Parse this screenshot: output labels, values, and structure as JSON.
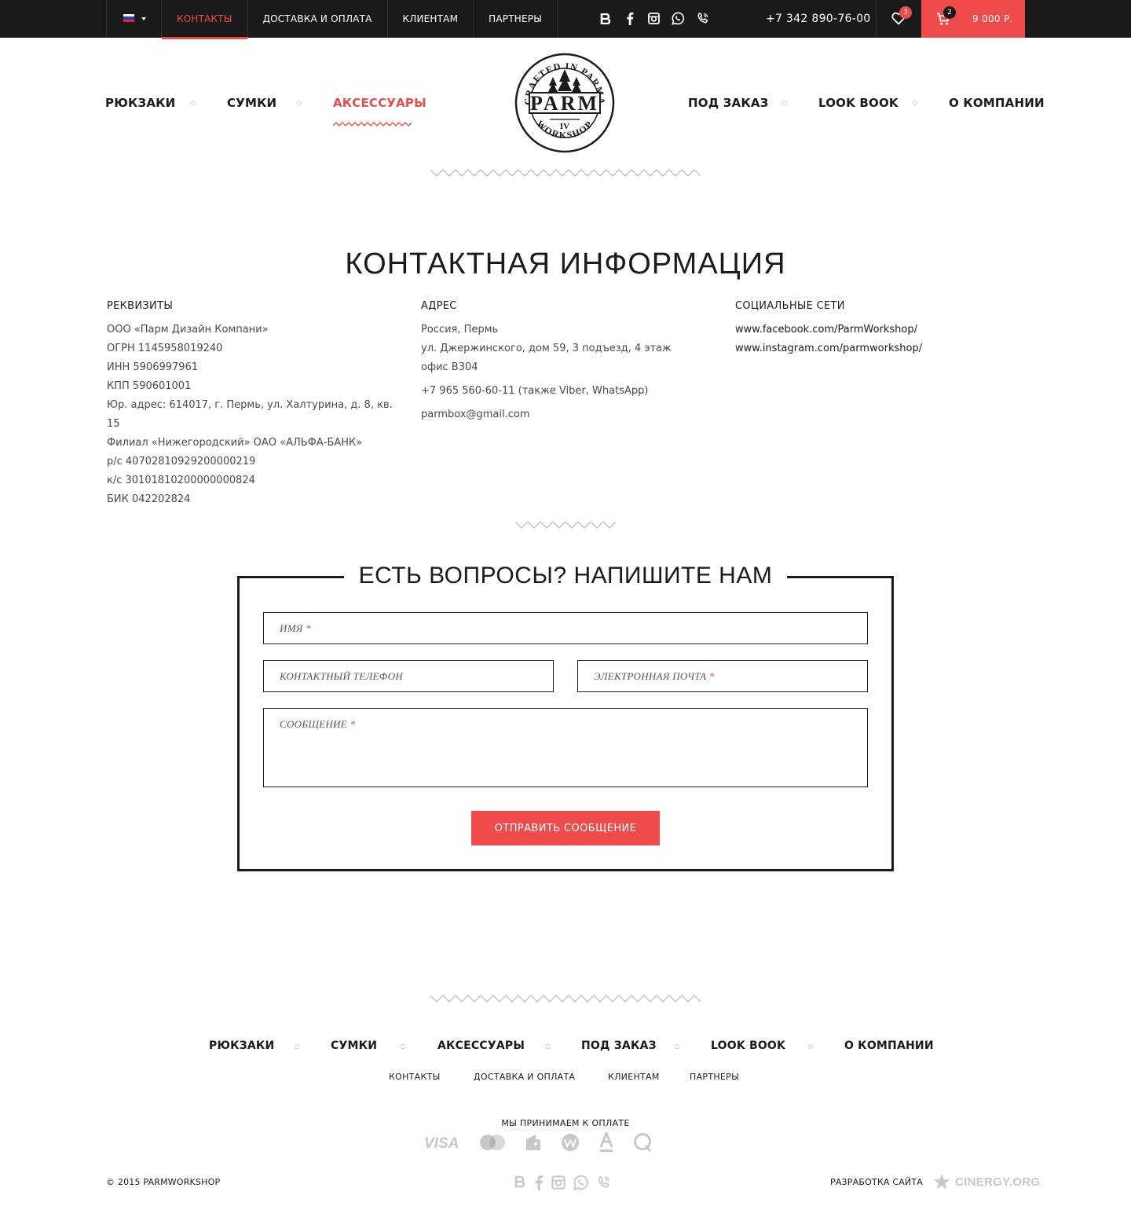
{
  "topbar": {
    "lang_flag": "ru-flag-icon",
    "links": [
      {
        "label": "КОНТАКТЫ",
        "active": true
      },
      {
        "label": "ДОСТАВКА И ОПЛАТА"
      },
      {
        "label": "КЛИЕНТАМ"
      },
      {
        "label": "ПАРТНЕРЫ"
      }
    ],
    "social_icons": [
      "vk-icon",
      "facebook-icon",
      "instagram-icon",
      "whatsapp-icon",
      "viber-icon"
    ],
    "phone": "+7 342 890-76-00",
    "favorites_count": "3",
    "cart_count": "2",
    "cart_total": "9 000 Р."
  },
  "main_nav": {
    "left": [
      "РЮКЗАКИ",
      "СУМКИ",
      "АКСЕССУАРЫ"
    ],
    "right": [
      "ПОД ЗАКАЗ",
      "LOOK BOOK",
      "О КОМПАНИИ"
    ],
    "active": "АКСЕССУАРЫ"
  },
  "logo": {
    "top_text": "CRAFTED IN PARMA",
    "main_text": "PARM",
    "numeral": "IV",
    "bottom_text": "WORKSHOP"
  },
  "page_title": "КОНТАКТНАЯ ИНФОРМАЦИЯ",
  "requisites": {
    "heading": "РЕКВИЗИТЫ",
    "lines": [
      "ООО «Парм Дизайн Компани»",
      "ОГРН 1145958019240",
      "ИНН 5906997961",
      "КПП 590601001",
      "Юр. адрес: 614017, г. Пермь, ул. Халтурина, д. 8, кв. 15",
      "Филиал «Нижегородский» ОАО «АЛЬФА-БАНК»",
      "р/с 40702810929200000219",
      "к/с 30101810200000000824",
      "БИК 042202824"
    ]
  },
  "address": {
    "heading": "АДРЕС",
    "lines": [
      "Россия, Пермь",
      "ул. Джержинского, дом 59, 3 подъезд, 4 этаж",
      "офис В304"
    ],
    "phone": "+7 965 560-60-11 (также Viber, WhatsApp)",
    "email": "parmbox@gmail.com"
  },
  "social": {
    "heading": "СОЦИАЛЬНЫЕ СЕТИ",
    "links": [
      "www.facebook.com/ParmWorkshop/",
      "www.instagram.com/parmworkshop/"
    ]
  },
  "form": {
    "title": "ЕСТЬ ВОПРОСЫ? НАПИШИТЕ НАМ",
    "name_placeholder": "ИМЯ",
    "phone_placeholder": "КОНТАКТНЫЙ ТЕЛЕФОН",
    "email_placeholder": "ЭЛЕКТРОННАЯ ПОЧТА",
    "message_placeholder": "СООБЩЕНИЕ",
    "required_mark": "*",
    "submit_label": "ОТПРАВИТЬ СООБЩЕНИЕ"
  },
  "footer": {
    "nav": [
      "РЮКЗАКИ",
      "СУМКИ",
      "АКСЕССУАРЫ",
      "ПОД ЗАКАЗ",
      "LOOK BOOK",
      "О КОМПАНИИ"
    ],
    "sub_nav": [
      "КОНТАКТЫ",
      "ДОСТАВКА И ОПЛАТА",
      "КЛИЕНТАМ",
      "ПАРТНЕРЫ"
    ],
    "payments_title": "МЫ ПРИНИМАЕМ К ОПЛАТЕ",
    "payment_icons": [
      "visa-icon",
      "mastercard-icon",
      "yandex-money-icon",
      "webmoney-icon",
      "alfa-bank-icon",
      "qiwi-icon"
    ],
    "copyright": "© 2015 PARMWORKSHOP",
    "dev_label": "РАЗРАБОТКА САЙТА",
    "dev_company": "CINERGY.ORG"
  },
  "colors": {
    "accent": "#ef4b4b",
    "dark": "#1a1a1a",
    "muted_icon": "#c8c8c8"
  }
}
